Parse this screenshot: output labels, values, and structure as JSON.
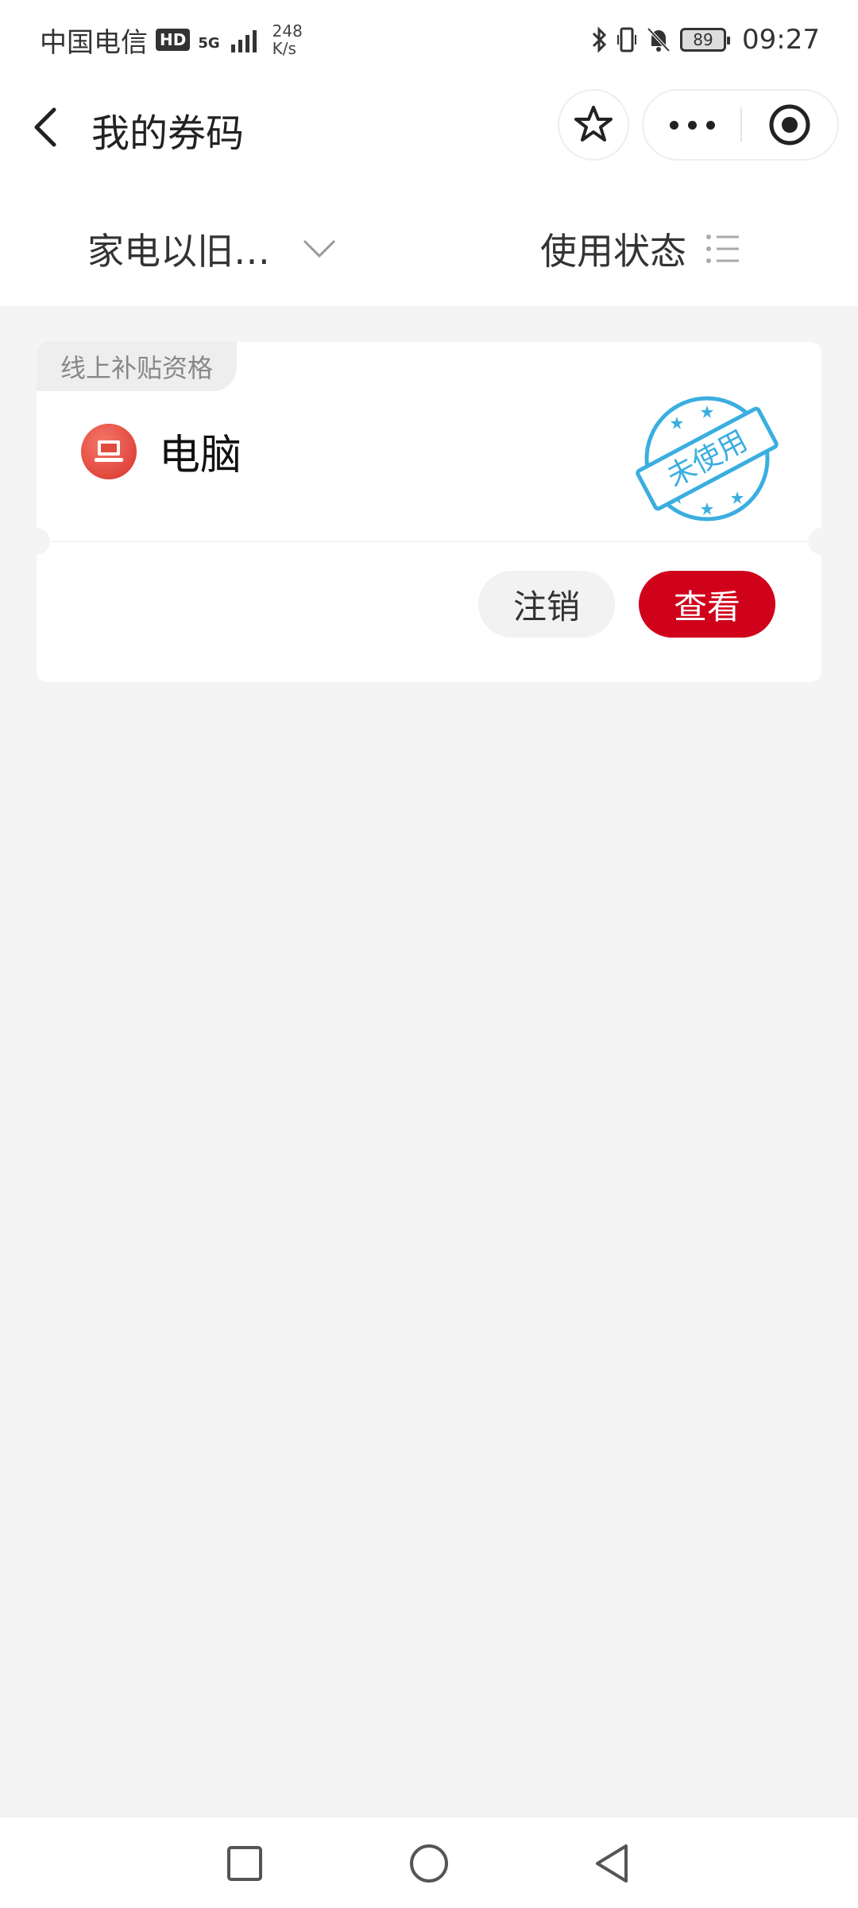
{
  "status_bar": {
    "carrier": "中国电信",
    "hd_badge": "HD",
    "network_type": "5G",
    "net_speed_value": "248",
    "net_speed_unit": "K/s",
    "battery": "89",
    "time": "09:27",
    "icons": [
      "bluetooth-icon",
      "vibrate-icon",
      "mute-bell-icon",
      "battery-icon"
    ]
  },
  "nav": {
    "title": "我的券码",
    "icons": [
      "back-arrow-icon",
      "star-icon",
      "more-dots-icon",
      "target-icon"
    ]
  },
  "filters": {
    "category": "家电以旧…",
    "status": "使用状态",
    "icons": [
      "chevron-down-icon",
      "list-icon"
    ]
  },
  "card": {
    "tag": "线上补贴资格",
    "product": "电脑",
    "stamp_text": "未使用",
    "cancel_label": "注销",
    "view_label": "查看",
    "colors": {
      "primary_red": "#d0021b",
      "stamp_blue": "#3aaee0"
    }
  },
  "system_nav": {
    "icons": [
      "square-recent-icon",
      "circle-home-icon",
      "triangle-back-icon"
    ]
  }
}
